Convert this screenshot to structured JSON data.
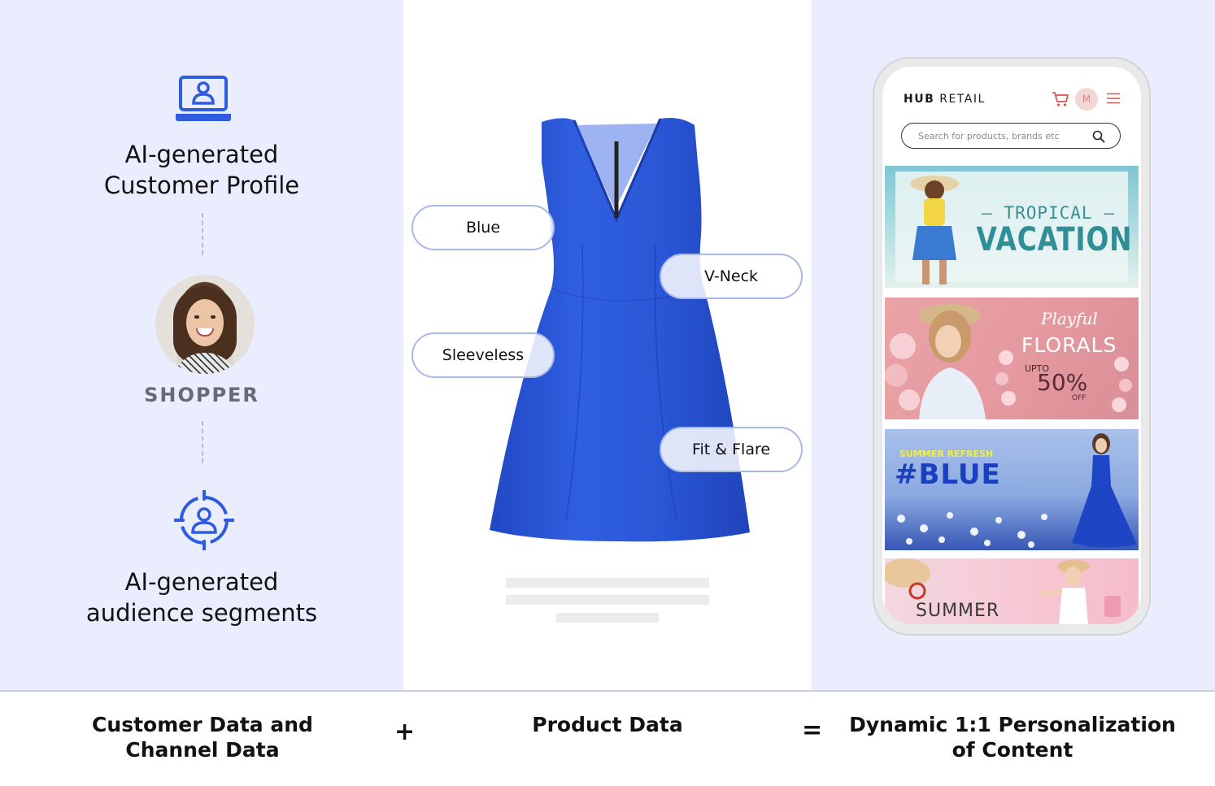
{
  "left": {
    "profile_label_line1": "AI-generated",
    "profile_label_line2": "Customer Profile",
    "shopper_label": "SHOPPER",
    "segments_label_line1": "AI-generated",
    "segments_label_line2": "audience segments",
    "icon_color": "#2f5bdf"
  },
  "product": {
    "tags": [
      "Blue",
      "V-Neck",
      "Sleeveless",
      "Fit & Flare"
    ],
    "dress_color": "#2a57d6"
  },
  "phone": {
    "brand_bold": "HUB",
    "brand_rest": "RETAIL",
    "avatar_initial": "M",
    "search_placeholder": "Search for products, brands etc",
    "accent_color": "#d9534f",
    "banners": {
      "tropical": "TROPICAL",
      "vacation": "VACATION",
      "playful": "Playful",
      "florals": "FLORALS",
      "upto": "UPTO",
      "fifty": "50%",
      "off": "OFF",
      "summer_refresh": "SUMMER REFRESH",
      "blue": "#BLUE",
      "summer": "SUMMER"
    }
  },
  "bottom": {
    "left_line1": "Customer Data and",
    "left_line2": "Channel Data",
    "plus": "+",
    "middle": "Product Data",
    "equals": "=",
    "right_line1": "Dynamic 1:1 Personalization",
    "right_line2": "of Content"
  }
}
